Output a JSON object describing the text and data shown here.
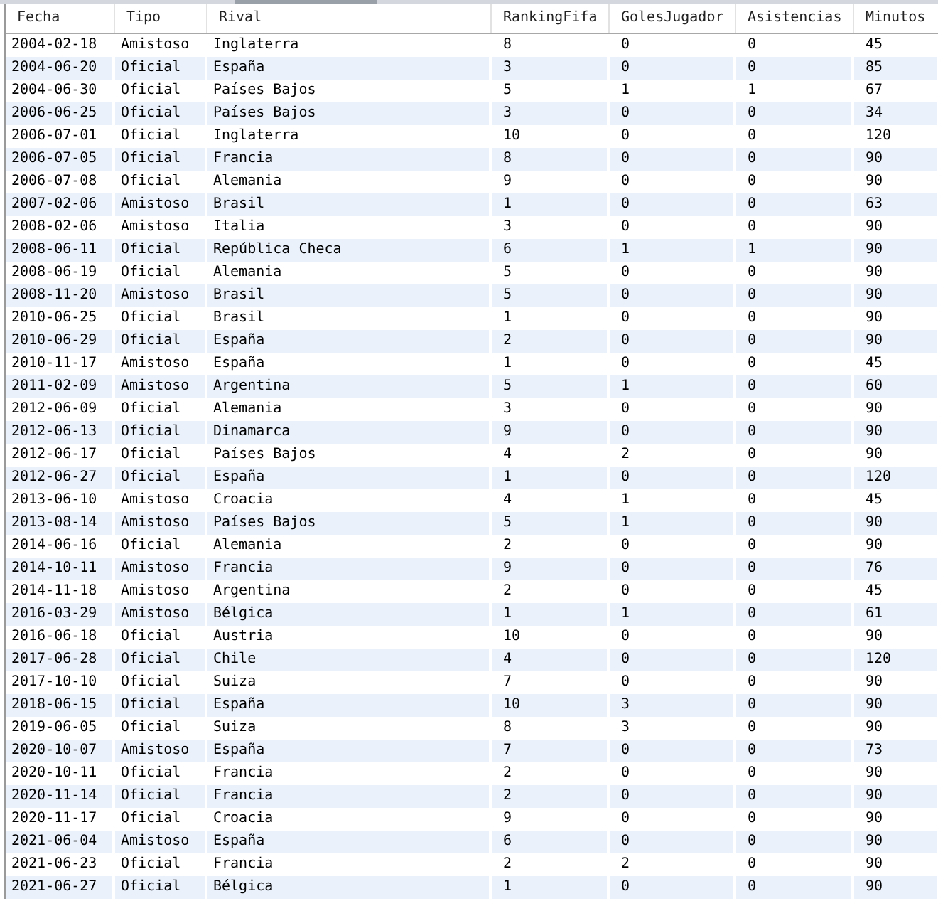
{
  "table": {
    "columns": [
      "Fecha",
      "Tipo",
      "Rival",
      "RankingFifa",
      "GolesJugador",
      "Asistencias",
      "Minutos"
    ],
    "rows": [
      [
        "2004-02-18",
        "Amistoso",
        "Inglaterra",
        "8",
        "0",
        "0",
        "45"
      ],
      [
        "2004-06-20",
        "Oficial",
        "España",
        "3",
        "0",
        "0",
        "85"
      ],
      [
        "2004-06-30",
        "Oficial",
        "Países Bajos",
        "5",
        "1",
        "1",
        "67"
      ],
      [
        "2006-06-25",
        "Oficial",
        "Países Bajos",
        "3",
        "0",
        "0",
        "34"
      ],
      [
        "2006-07-01",
        "Oficial",
        "Inglaterra",
        "10",
        "0",
        "0",
        "120"
      ],
      [
        "2006-07-05",
        "Oficial",
        "Francia",
        "8",
        "0",
        "0",
        "90"
      ],
      [
        "2006-07-08",
        "Oficial",
        "Alemania",
        "9",
        "0",
        "0",
        "90"
      ],
      [
        "2007-02-06",
        "Amistoso",
        "Brasil",
        "1",
        "0",
        "0",
        "63"
      ],
      [
        "2008-02-06",
        "Amistoso",
        "Italia",
        "3",
        "0",
        "0",
        "90"
      ],
      [
        "2008-06-11",
        "Oficial",
        "República Checa",
        "6",
        "1",
        "1",
        "90"
      ],
      [
        "2008-06-19",
        "Oficial",
        "Alemania",
        "5",
        "0",
        "0",
        "90"
      ],
      [
        "2008-11-20",
        "Amistoso",
        "Brasil",
        "5",
        "0",
        "0",
        "90"
      ],
      [
        "2010-06-25",
        "Oficial",
        "Brasil",
        "1",
        "0",
        "0",
        "90"
      ],
      [
        "2010-06-29",
        "Oficial",
        "España",
        "2",
        "0",
        "0",
        "90"
      ],
      [
        "2010-11-17",
        "Amistoso",
        "España",
        "1",
        "0",
        "0",
        "45"
      ],
      [
        "2011-02-09",
        "Amistoso",
        "Argentina",
        "5",
        "1",
        "0",
        "60"
      ],
      [
        "2012-06-09",
        "Oficial",
        "Alemania",
        "3",
        "0",
        "0",
        "90"
      ],
      [
        "2012-06-13",
        "Oficial",
        "Dinamarca",
        "9",
        "0",
        "0",
        "90"
      ],
      [
        "2012-06-17",
        "Oficial",
        "Países Bajos",
        "4",
        "2",
        "0",
        "90"
      ],
      [
        "2012-06-27",
        "Oficial",
        "España",
        "1",
        "0",
        "0",
        "120"
      ],
      [
        "2013-06-10",
        "Amistoso",
        "Croacia",
        "4",
        "1",
        "0",
        "45"
      ],
      [
        "2013-08-14",
        "Amistoso",
        "Países Bajos",
        "5",
        "1",
        "0",
        "90"
      ],
      [
        "2014-06-16",
        "Oficial",
        "Alemania",
        "2",
        "0",
        "0",
        "90"
      ],
      [
        "2014-10-11",
        "Amistoso",
        "Francia",
        "9",
        "0",
        "0",
        "76"
      ],
      [
        "2014-11-18",
        "Amistoso",
        "Argentina",
        "2",
        "0",
        "0",
        "45"
      ],
      [
        "2016-03-29",
        "Amistoso",
        "Bélgica",
        "1",
        "1",
        "0",
        "61"
      ],
      [
        "2016-06-18",
        "Oficial",
        "Austria",
        "10",
        "0",
        "0",
        "90"
      ],
      [
        "2017-06-28",
        "Oficial",
        "Chile",
        "4",
        "0",
        "0",
        "120"
      ],
      [
        "2017-10-10",
        "Oficial",
        "Suiza",
        "7",
        "0",
        "0",
        "90"
      ],
      [
        "2018-06-15",
        "Oficial",
        "España",
        "10",
        "3",
        "0",
        "90"
      ],
      [
        "2019-06-05",
        "Oficial",
        "Suiza",
        "8",
        "3",
        "0",
        "90"
      ],
      [
        "2020-10-07",
        "Amistoso",
        "España",
        "7",
        "0",
        "0",
        "73"
      ],
      [
        "2020-10-11",
        "Oficial",
        "Francia",
        "2",
        "0",
        "0",
        "90"
      ],
      [
        "2020-11-14",
        "Oficial",
        "Francia",
        "2",
        "0",
        "0",
        "90"
      ],
      [
        "2020-11-17",
        "Oficial",
        "Croacia",
        "9",
        "0",
        "0",
        "90"
      ],
      [
        "2021-06-04",
        "Amistoso",
        "España",
        "6",
        "0",
        "0",
        "90"
      ],
      [
        "2021-06-23",
        "Oficial",
        "Francia",
        "2",
        "2",
        "0",
        "90"
      ],
      [
        "2021-06-27",
        "Oficial",
        "Bélgica",
        "1",
        "0",
        "0",
        "90"
      ]
    ]
  }
}
